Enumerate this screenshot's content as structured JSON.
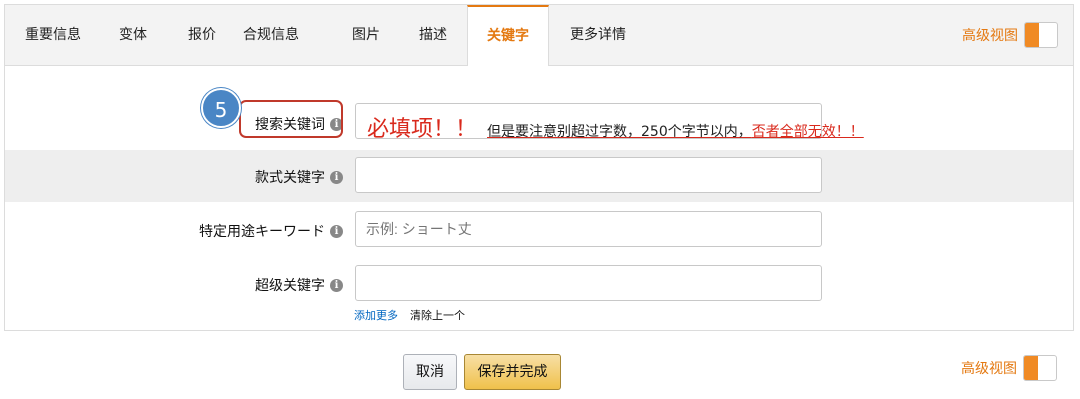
{
  "tabs": [
    {
      "label": "重要信息"
    },
    {
      "label": "变体"
    },
    {
      "label": "报价"
    },
    {
      "label": "合规信息"
    },
    {
      "label": "图片"
    },
    {
      "label": "描述"
    },
    {
      "label": "关键字"
    },
    {
      "label": "更多详情"
    }
  ],
  "active_tab": "关键字",
  "advanced_view": {
    "label": "高级视图",
    "on": true
  },
  "annotation": {
    "step_number": "5",
    "required_text": "必填项！！",
    "note_plain": "但是要注意别超过字数，250个字节以内，",
    "note_red": "否者全部无效！！"
  },
  "fields": [
    {
      "label": "搜索关键词",
      "value": "",
      "placeholder": ""
    },
    {
      "label": "款式关键字",
      "value": "",
      "placeholder": ""
    },
    {
      "label": "特定用途キーワード",
      "value": "",
      "placeholder": "示例: ショート丈"
    },
    {
      "label": "超级关键字",
      "value": "",
      "placeholder": ""
    }
  ],
  "info_icon": "i",
  "links": {
    "add_more": "添加更多",
    "clear_last": "清除上一个"
  },
  "buttons": {
    "cancel": "取消",
    "save_finish": "保存并完成"
  },
  "colors": {
    "accent": "#e47911",
    "annotation_red": "#d9291c",
    "badge_blue": "#4a86c5",
    "save_button": "#f0c14b"
  }
}
